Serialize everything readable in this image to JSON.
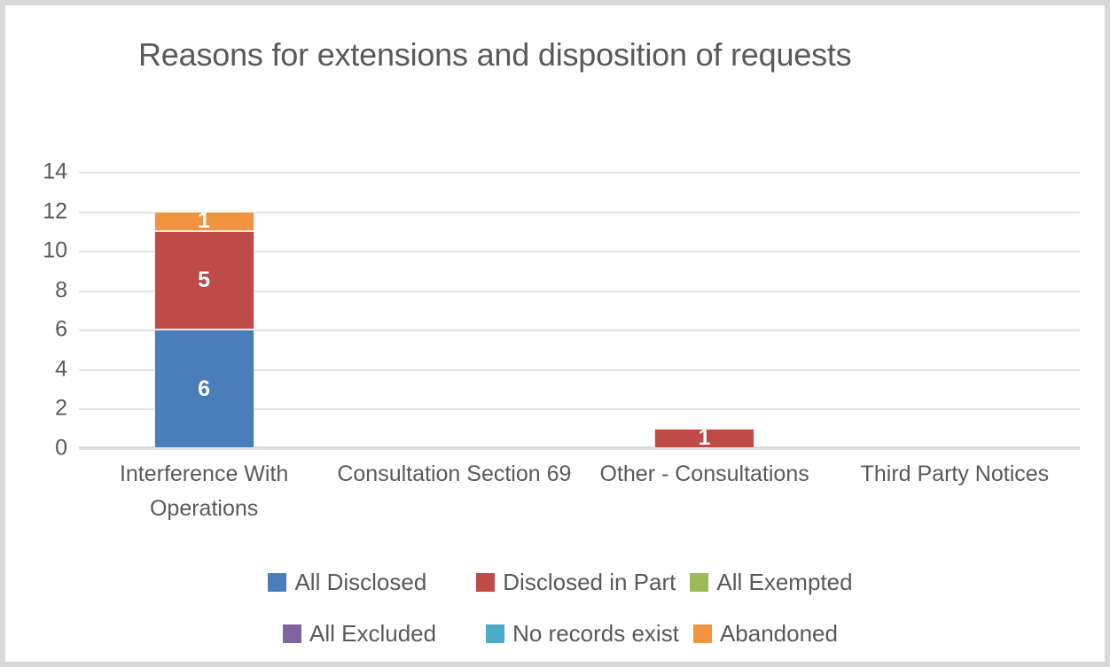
{
  "chart_data": {
    "type": "bar",
    "subtype": "stacked-column",
    "title": "Reasons for extensions and disposition of requests",
    "xlabel": "",
    "ylabel": "",
    "ylim": [
      0,
      14
    ],
    "ytick_step": 2,
    "yticks": [
      14,
      12,
      10,
      8,
      6,
      4,
      2,
      0
    ],
    "grid": true,
    "legend_position": "bottom",
    "categories": [
      "Interference With Operations",
      "Consultation Section 69",
      "Other - Consultations",
      "Third Party Notices"
    ],
    "series": [
      {
        "name": "All Disclosed",
        "color": "#4a7ebb",
        "values": [
          6,
          0,
          0,
          0
        ]
      },
      {
        "name": "Disclosed in Part",
        "color": "#be4b48",
        "values": [
          5,
          0,
          1,
          0
        ]
      },
      {
        "name": "All Exempted",
        "color": "#9bbb59",
        "values": [
          0,
          0,
          0,
          0
        ]
      },
      {
        "name": "All Excluded",
        "color": "#8064a2",
        "values": [
          0,
          0,
          0,
          0
        ]
      },
      {
        "name": "No records exist",
        "color": "#4bacc6",
        "values": [
          0,
          0,
          0,
          0
        ]
      },
      {
        "name": "Abandoned",
        "color": "#f2943f",
        "values": [
          1,
          0,
          0,
          0
        ]
      }
    ],
    "data_labels": {
      "Interference With Operations": [
        {
          "series": "All Disclosed",
          "label": "6"
        },
        {
          "series": "Disclosed in Part",
          "label": "5"
        },
        {
          "series": "Abandoned",
          "label": "1"
        }
      ],
      "Other - Consultations": [
        {
          "series": "Disclosed in Part",
          "label": "1"
        }
      ]
    },
    "totals": [
      12,
      0,
      1,
      0
    ]
  },
  "legend": {
    "rows": [
      [
        {
          "label": "All Disclosed",
          "color": "#4a7ebb"
        },
        {
          "label": "Disclosed in Part",
          "color": "#be4b48"
        },
        {
          "label": "All Exempted",
          "color": "#9bbb59"
        }
      ],
      [
        {
          "label": "All Excluded",
          "color": "#8064a2"
        },
        {
          "label": "No records exist",
          "color": "#4bacc6"
        },
        {
          "label": "Abandoned",
          "color": "#f2943f"
        }
      ]
    ]
  },
  "style": {
    "border_color": "#d9d9d9",
    "text_color": "#595959",
    "gridline_color": "#e2e2e2",
    "background": "#ffffff"
  }
}
